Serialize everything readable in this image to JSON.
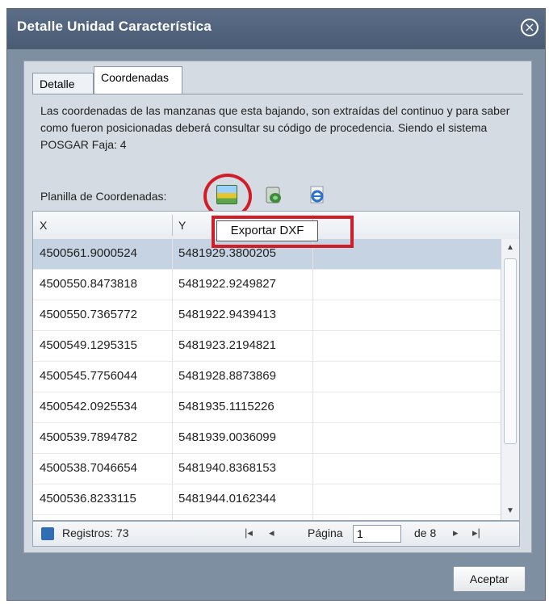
{
  "window": {
    "title": "Detalle Unidad Característica",
    "close_glyph": "×"
  },
  "tabs": [
    {
      "label": "Detalle"
    },
    {
      "label": "Coordenadas"
    }
  ],
  "content": {
    "description": "Las coordenadas de las manzanas que esta bajando, son extraídas del continuo y para saber como fueron posicionadas deberá consultar su código de procedencia. Siendo el sistema POSGAR Faja: 4",
    "planilla_label": "Planilla de Coordenadas:",
    "toolbar_icons": [
      "excel-export-icon",
      "database-icon",
      "internet-explorer-icon"
    ],
    "tooltip": "Exportar DXF"
  },
  "grid": {
    "columns": [
      "X",
      "Y"
    ],
    "rows": [
      [
        "4500561.9000524",
        "5481929.3800205"
      ],
      [
        "4500550.8473818",
        "5481922.9249827"
      ],
      [
        "4500550.7365772",
        "5481922.9439413"
      ],
      [
        "4500549.1295315",
        "5481923.2194821"
      ],
      [
        "4500545.7756044",
        "5481928.8873869"
      ],
      [
        "4500542.0925534",
        "5481935.1115226"
      ],
      [
        "4500539.7894782",
        "5481939.0036099"
      ],
      [
        "4500538.7046654",
        "5481940.8368153"
      ],
      [
        "4500536.8233115",
        "5481944.0162344"
      ]
    ],
    "selected_row": 0
  },
  "pager": {
    "registros": "Registros: 73",
    "first": "|◂",
    "prev": "◂",
    "pagina_label": "Página",
    "page_value": "1",
    "de_text": "de 8",
    "next": "▸",
    "last": "▸|"
  },
  "buttons": {
    "accept": "Aceptar"
  },
  "colors": {
    "highlight": "#d01d27",
    "selected_row": "#c5d3e3"
  }
}
